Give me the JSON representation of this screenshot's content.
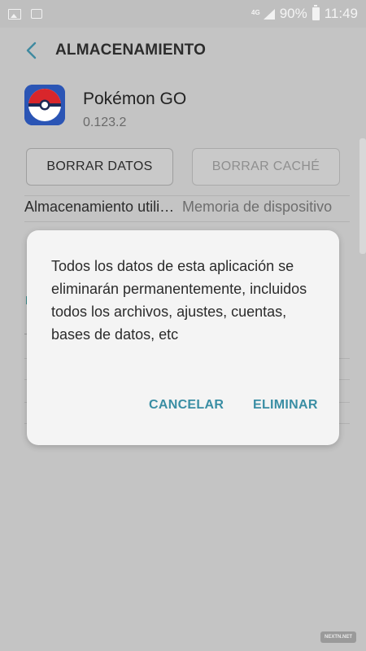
{
  "status_bar": {
    "network": "4G",
    "battery": "90%",
    "time": "11:49",
    "icons": [
      "gallery-icon",
      "notification-box-icon",
      "signal-icon",
      "battery-icon"
    ]
  },
  "header": {
    "back_icon": "chevron-left-icon",
    "title": "ALMACENAMIENTO"
  },
  "app": {
    "name": "Pokémon GO",
    "version": "0.123.2",
    "icon": "pokeball-icon"
  },
  "buttons": {
    "clear_data": "BORRAR DATOS",
    "clear_cache": "BORRAR CACHÉ"
  },
  "storage": {
    "label": "Almacenamiento utilizado",
    "value": "Memoria de dispositivo"
  },
  "dialog": {
    "message": "Todos los datos de esta aplicación se eliminarán permanentemente, incluidos todos los archivos, ajustes, cuentas, bases de datos, etc",
    "cancel": "CANCELAR",
    "delete": "ELIMINAR"
  },
  "watermark": "NEXTN.NET",
  "colors": {
    "accent": "#3a8ea4",
    "dialog_bg": "#f4f4f4",
    "background": "#c4c4c4"
  }
}
